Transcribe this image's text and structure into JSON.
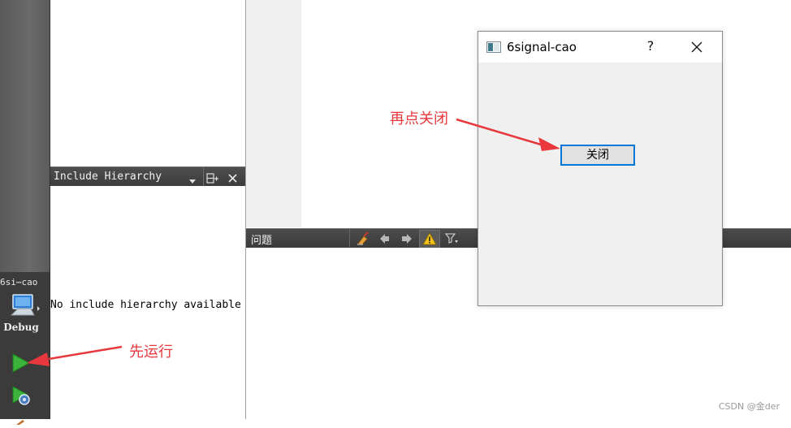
{
  "modebar": {
    "kit_label": "6si⋯cao",
    "build_label": "Debug"
  },
  "hierarchy": {
    "title": "Include Hierarchy",
    "empty_text": "No include hierarchy available"
  },
  "issues": {
    "title": "问题"
  },
  "dialog": {
    "title": "6signal-cao",
    "help": "?",
    "button_label": "关闭"
  },
  "annotations": {
    "click_close": "再点关闭",
    "run_first": "先运行"
  },
  "watermark": "CSDN @金der",
  "colors": {
    "annotation": "#e8383d",
    "focus_border": "#0078d7",
    "run_green": "#3cb43c"
  },
  "icons": [
    "monitor-icon",
    "run-icon",
    "debug-run-icon",
    "dropdown-icon",
    "split-icon",
    "close-icon",
    "clear-icon",
    "prev-icon",
    "next-icon",
    "warning-icon",
    "filter-icon",
    "app-window-icon"
  ]
}
